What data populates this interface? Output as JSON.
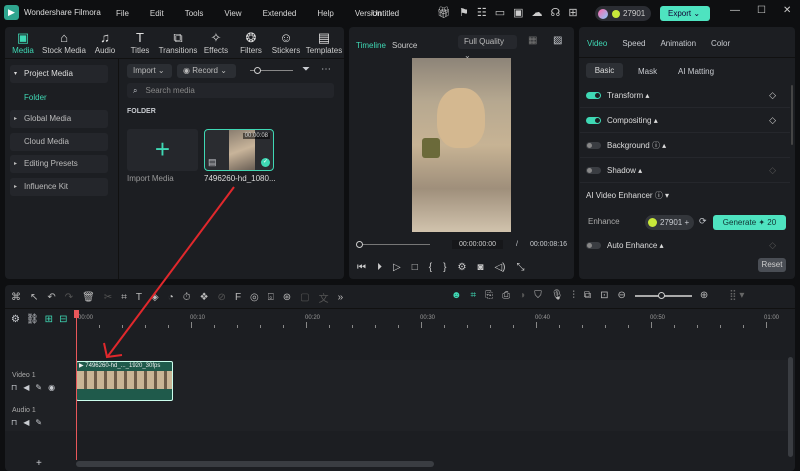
{
  "app": {
    "name": "Wondershare Filmora",
    "project_title": "Untitled",
    "credits": "27901",
    "export_label": "Export"
  },
  "menu": [
    "File",
    "Edit",
    "Tools",
    "View",
    "Extended",
    "Help",
    "Version"
  ],
  "media_tabs": [
    {
      "label": "Media",
      "icon": "media-icon",
      "glyph": "▣"
    },
    {
      "label": "Stock Media",
      "icon": "stock-media-icon",
      "glyph": "⌂"
    },
    {
      "label": "Audio",
      "icon": "audio-icon",
      "glyph": "♫"
    },
    {
      "label": "Titles",
      "icon": "titles-icon",
      "glyph": "T"
    },
    {
      "label": "Transitions",
      "icon": "transitions-icon",
      "glyph": "⧉"
    },
    {
      "label": "Effects",
      "icon": "effects-icon",
      "glyph": "✧"
    },
    {
      "label": "Filters",
      "icon": "filters-icon",
      "glyph": "❂"
    },
    {
      "label": "Stickers",
      "icon": "stickers-icon",
      "glyph": "☺"
    },
    {
      "label": "Templates",
      "icon": "templates-icon",
      "glyph": "▤"
    }
  ],
  "sidebar": {
    "project_media": "Project Media",
    "folder": "Folder",
    "global_media": "Global Media",
    "cloud_media": "Cloud Media",
    "editing_presets": "Editing Presets",
    "influence_kit": "Influence Kit"
  },
  "media": {
    "import": "Import",
    "record": "Record",
    "search_placeholder": "Search media",
    "folder_heading": "FOLDER",
    "import_media": "Import Media",
    "clip_name": "7496260-hd_1080...",
    "clip_duration": "00:00:08"
  },
  "preview": {
    "tab_timeline": "Timeline",
    "tab_source": "Source",
    "quality": "Full Quality",
    "current_time": "00:00:00:00",
    "separator": "/",
    "total_time": "00:00:08:16"
  },
  "properties": {
    "tabs": [
      "Video",
      "Speed",
      "Animation",
      "Color"
    ],
    "subtabs": [
      "Basic",
      "Mask",
      "AI Matting"
    ],
    "transform": "Transform",
    "compositing": "Compositing",
    "background": "Background",
    "shadow": "Shadow",
    "ai_enhancer": "AI Video Enhancer",
    "enhance": "Enhance",
    "enhance_credits": "27901",
    "generate": "Generate",
    "generate_cost": "20",
    "auto_enhance": "Auto Enhance",
    "reset": "Reset"
  },
  "timeline": {
    "ruler": [
      "00:00",
      "00:10",
      "00:20",
      "00:30",
      "00:40",
      "00:50",
      "01:00"
    ],
    "video_track": "Video 1",
    "audio_track": "Audio 1",
    "clip_label": "7496260-hd_..._1920_30fps"
  },
  "colors": {
    "accent": "#3fd8b4",
    "playhead": "#e8575a",
    "annotation_arrow": "#e0282c"
  }
}
